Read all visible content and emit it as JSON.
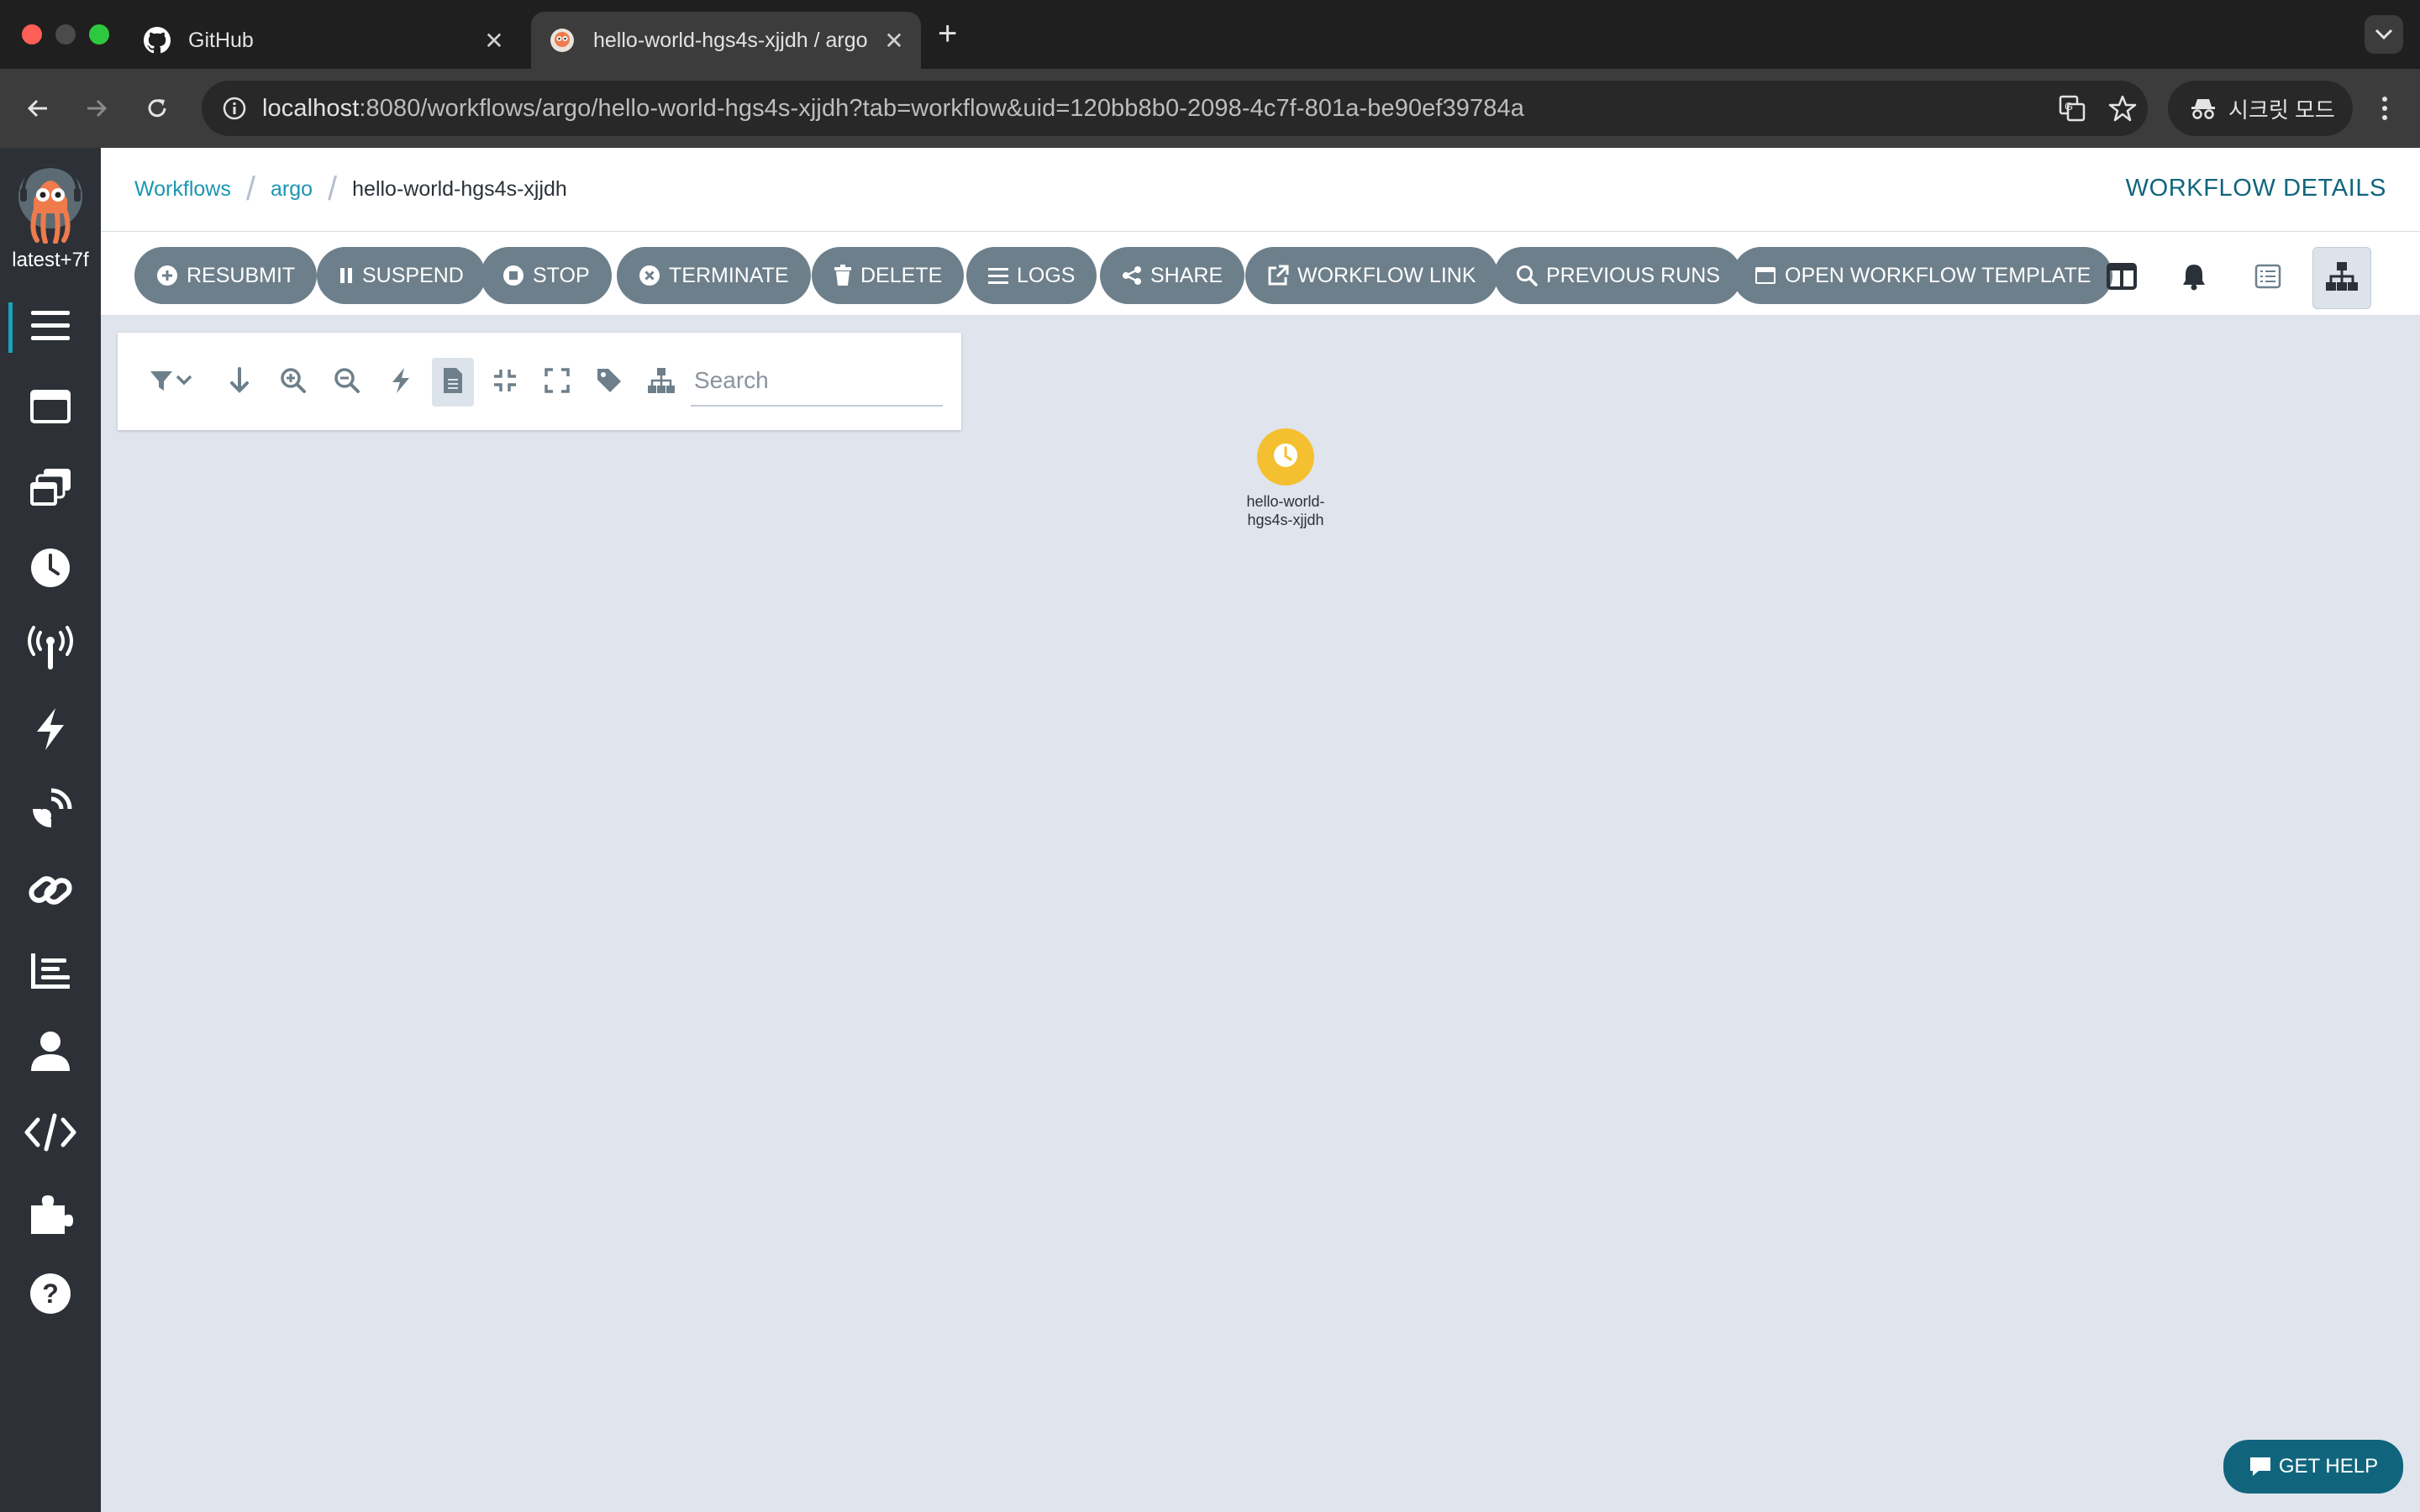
{
  "browser": {
    "tabs": [
      {
        "title": "GitHub",
        "icon": "github-icon"
      },
      {
        "title": "hello-world-hgs4s-xjjdh / argo",
        "icon": "argo-icon"
      }
    ],
    "url_host": "localhost",
    "url_rest": ":8080/workflows/argo/hello-world-hgs4s-xjjdh?tab=workflow&uid=120bb8b0-2098-4c7f-801a-be90ef39784a",
    "incognito_label": "시크릿 모드"
  },
  "sidebar": {
    "version": "latest+7f",
    "items": [
      {
        "icon": "workflows-icon"
      },
      {
        "icon": "workflow-templates-icon"
      },
      {
        "icon": "cluster-templates-icon"
      },
      {
        "icon": "cron-workflows-icon"
      },
      {
        "icon": "event-sources-icon"
      },
      {
        "icon": "sensors-icon"
      },
      {
        "icon": "event-flow-icon"
      },
      {
        "icon": "links-icon"
      },
      {
        "icon": "reports-icon"
      },
      {
        "icon": "user-icon"
      },
      {
        "icon": "api-docs-icon"
      },
      {
        "icon": "plugins-icon"
      },
      {
        "icon": "help-icon"
      }
    ]
  },
  "breadcrumb": {
    "workflows": "Workflows",
    "namespace": "argo",
    "current": "hello-world-hgs4s-xjjdh"
  },
  "page_title": "WORKFLOW DETAILS",
  "actions": {
    "resubmit": "RESUBMIT",
    "suspend": "SUSPEND",
    "stop": "STOP",
    "terminate": "TERMINATE",
    "delete": "DELETE",
    "logs": "LOGS",
    "share": "SHARE",
    "workflow_link": "WORKFLOW LINK",
    "previous_runs": "PREVIOUS RUNS",
    "open_template": "OPEN WORKFLOW TEMPLATE"
  },
  "graph": {
    "search_placeholder": "Search",
    "node": {
      "line1": "hello-world-",
      "line2": "hgs4s-xjjdh",
      "status": "pending",
      "color": "#f4c030"
    }
  },
  "help_button": "GET HELP",
  "colors": {
    "accent": "#10657d",
    "link": "#1a96b3",
    "button": "#6d7f8b",
    "sidebar": "#2d3137"
  }
}
